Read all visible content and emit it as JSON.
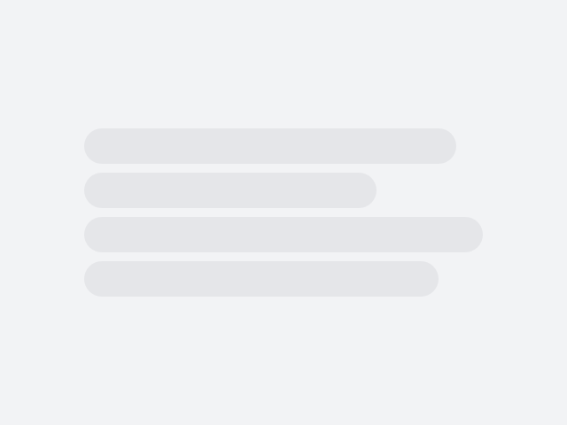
{
  "state": "loading",
  "colors": {
    "background": "#f2f3f5",
    "placeholder": "#e5e6e9"
  },
  "skeleton": {
    "line_count": 4
  }
}
